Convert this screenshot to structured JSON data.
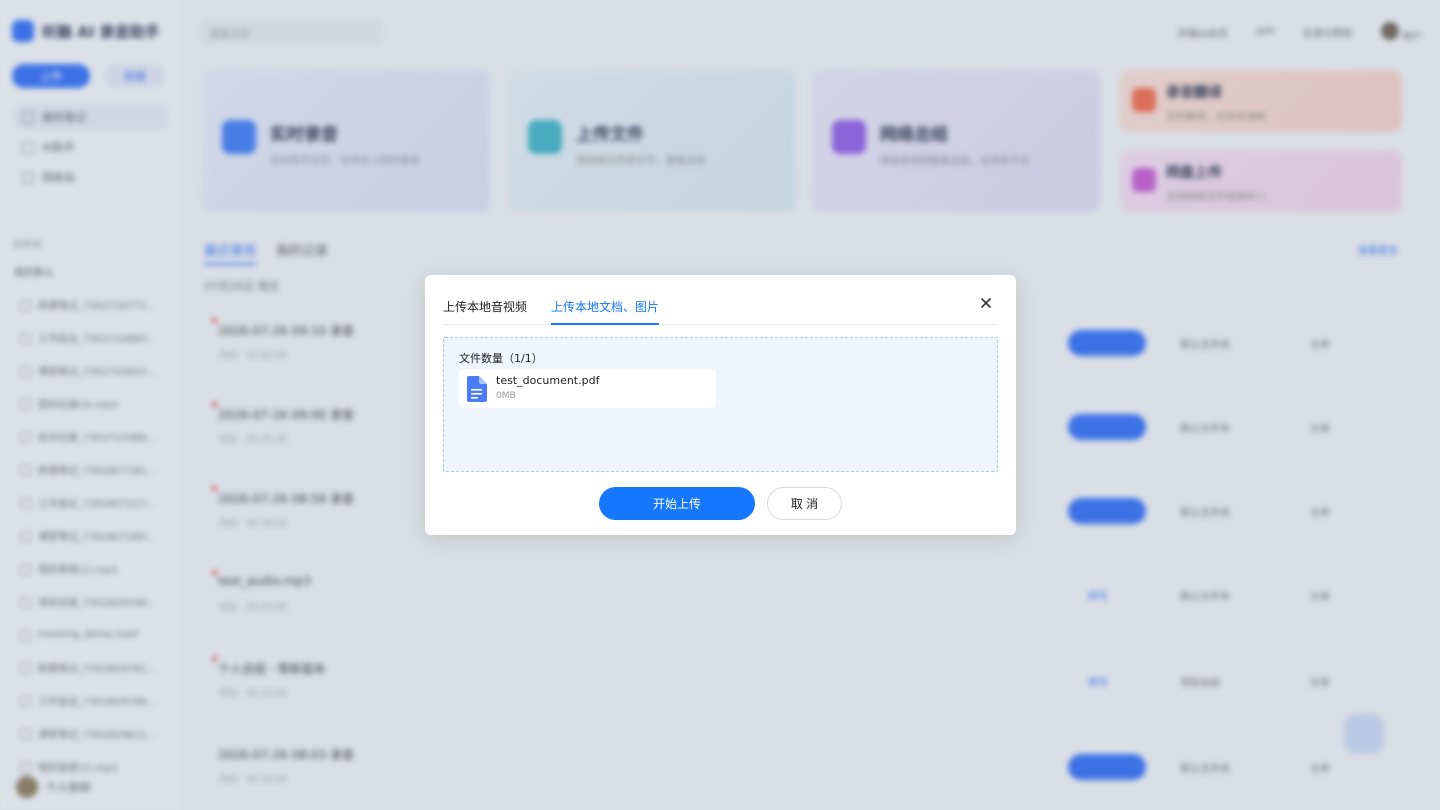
{
  "background": {
    "brand": "听脑 AI 录音助手",
    "sidebar_primary_btn": "上传",
    "sidebar_secondary_btn": "新建",
    "nav": [
      "我的笔记",
      "AI助手",
      "回收站"
    ],
    "section_label": "文件夹",
    "section_sub": "我的默认",
    "list": [
      "新建笔记_7352710771...",
      "工作会议_7352710883...",
      "课堂笔记_7352710922...",
      "我的记录(4).mp3",
      "采访记录_7352712486...",
      "新建笔记_7352827181...",
      "工作会议_7352827227...",
      "课堂笔记_7352827280...",
      "我的录音(1).mp3",
      "项目总结_7352829346...",
      "meeting_demo.mp4",
      "新建笔记_7352829781...",
      "工作会议_7352829799...",
      "课堂笔记_7352829812...",
      "我的录音(2).mp3"
    ],
    "user": "个人空间",
    "search_placeholder": "搜索文件",
    "top_links": [
      "听脑AI会员",
      "APP",
      "反馈与帮助"
    ],
    "top_user": "用户",
    "cards": [
      {
        "title": "实时录音",
        "sub": "实时转写文字，支持多人同时录音"
      },
      {
        "title": "上传文件",
        "sub": "音视频文件转文字，智能总结"
      },
      {
        "title": "网络总结",
        "sub": "链接音视频智能总结，支持多平台"
      }
    ],
    "small_cards": [
      {
        "title": "录音翻译",
        "sub": "实时翻译，支持多语种"
      },
      {
        "title": "网盘上传",
        "sub": "支持网盘文件直接导入"
      }
    ],
    "tabs": [
      "最近使用",
      "我的记录"
    ],
    "more": "查看更多",
    "date_label": "07月26日 周五",
    "rows": [
      {
        "title": "2026-07-26 09:10 录音",
        "meta": "时长 · 01:02:45",
        "folder": "默认文件夹",
        "share": "分享"
      },
      {
        "title": "2026-07-26 09:00 录音",
        "meta": "时长 · 00:45:30",
        "folder": "默认文件夹",
        "share": "分享"
      },
      {
        "title": "2026-07-26 08:58 录音",
        "meta": "时长 · 00:30:12",
        "folder": "默认文件夹",
        "share": "分享"
      },
      {
        "title": "test_audio.mp3",
        "meta": "时长 · 00:05:00",
        "link": "转写",
        "folder": "默认文件夹",
        "share": "分享"
      },
      {
        "title": "个人总结 · 等新版本",
        "meta": "时长 · 00:10:00",
        "link": "转写",
        "folder": "项目总结",
        "share": "分享"
      },
      {
        "title": "2026-07-26 08:03 录音",
        "meta": "时长 · 00:20:00",
        "folder": "默认文件夹",
        "share": "分享"
      }
    ]
  },
  "modal": {
    "tabs": [
      "上传本地音视频",
      "上传本地文档、图片"
    ],
    "active_tab": 1,
    "file_count_label": "文件数量（1/1）",
    "file": {
      "name": "test_document.pdf",
      "size": "0MB"
    },
    "start_button": "开始上传",
    "cancel_button": "取 消",
    "colors": {
      "primary": "#1677ff",
      "dropzone_bg": "#eef5ff",
      "file_icon": "#4d7cf7"
    }
  }
}
